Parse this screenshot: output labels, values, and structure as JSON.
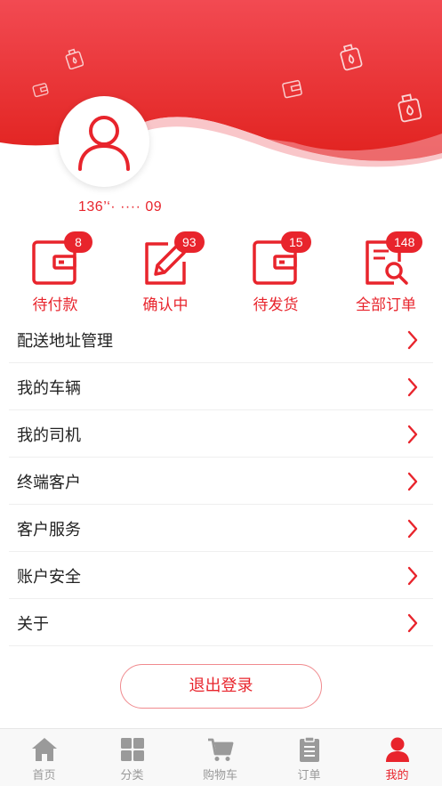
{
  "profile": {
    "phone": "136’‘· ···· 09"
  },
  "orders": [
    {
      "label": "待付款",
      "count": "8",
      "icon": "wallet-icon"
    },
    {
      "label": "确认中",
      "count": "93",
      "icon": "edit-icon"
    },
    {
      "label": "待发货",
      "count": "15",
      "icon": "wallet-icon"
    },
    {
      "label": "全部订单",
      "count": "148",
      "icon": "document-search-icon"
    }
  ],
  "menu": [
    {
      "label": "配送地址管理"
    },
    {
      "label": "我的车辆"
    },
    {
      "label": "我的司机"
    },
    {
      "label": "终端客户"
    },
    {
      "label": "客户服务"
    },
    {
      "label": "账户安全"
    },
    {
      "label": "关于"
    }
  ],
  "logout_label": "退出登录",
  "tabs": [
    {
      "label": "首页",
      "icon": "home-icon",
      "active": false
    },
    {
      "label": "分类",
      "icon": "grid-icon",
      "active": false
    },
    {
      "label": "购物车",
      "icon": "cart-icon",
      "active": false
    },
    {
      "label": "订单",
      "icon": "clipboard-icon",
      "active": false
    },
    {
      "label": "我的",
      "icon": "user-icon",
      "active": true
    }
  ],
  "colors": {
    "accent": "#e8242c",
    "header_gradient_top": "#f03c45",
    "header_gradient_bottom": "#e3201f"
  }
}
